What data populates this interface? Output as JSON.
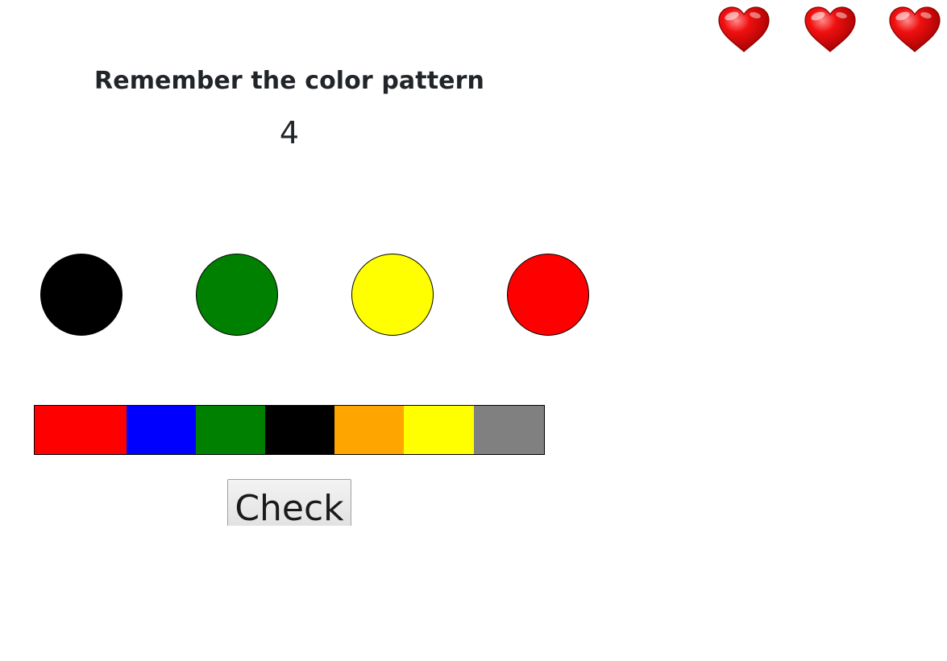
{
  "game": {
    "instruction": "Remember the color pattern",
    "countdown": "4",
    "check_label": "Check"
  },
  "lives": {
    "count": 3,
    "icon": "heart-icon",
    "color": "#e00000"
  },
  "pattern": [
    {
      "color_name": "black",
      "color": "#000000"
    },
    {
      "color_name": "green",
      "color": "#008000"
    },
    {
      "color_name": "yellow",
      "color": "#ffff00"
    },
    {
      "color_name": "red",
      "color": "#ff0000"
    }
  ],
  "palette": [
    {
      "color_name": "red",
      "color": "#ff0000"
    },
    {
      "color_name": "blue",
      "color": "#0000ff"
    },
    {
      "color_name": "green",
      "color": "#008000"
    },
    {
      "color_name": "black",
      "color": "#000000"
    },
    {
      "color_name": "orange",
      "color": "#ffa500"
    },
    {
      "color_name": "yellow",
      "color": "#ffff00"
    },
    {
      "color_name": "gray",
      "color": "#808080"
    }
  ]
}
